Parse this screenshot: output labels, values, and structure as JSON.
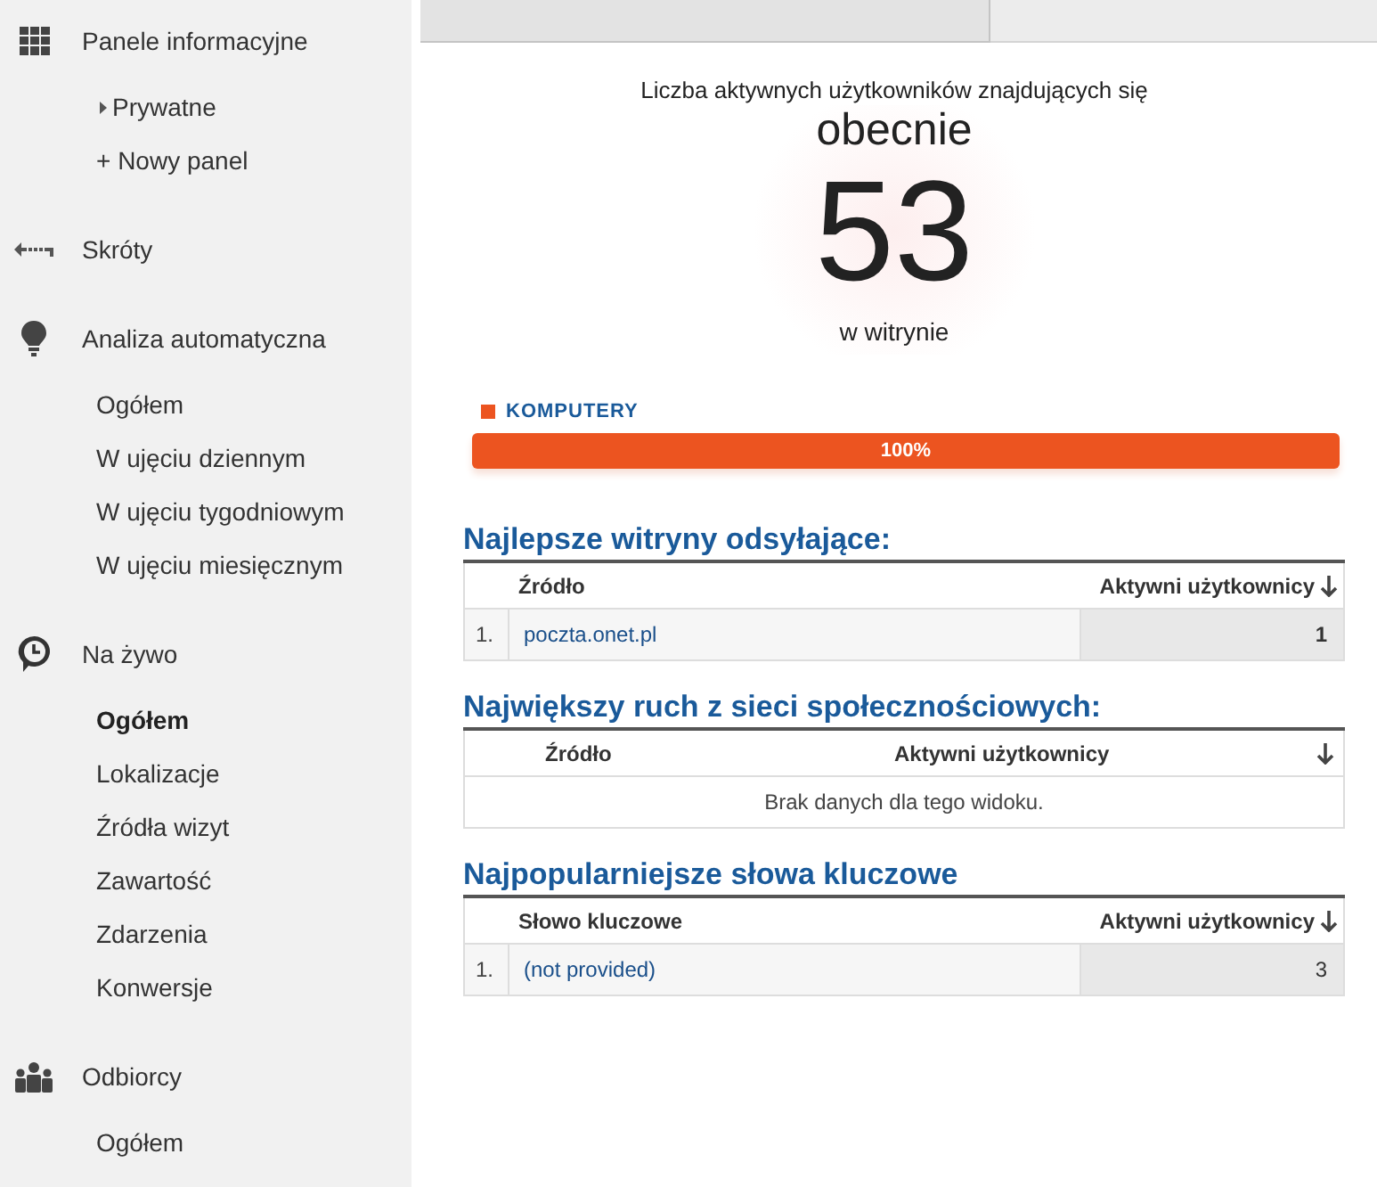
{
  "sidebar": {
    "sections": [
      {
        "label": "Panele informacyjne",
        "kind": "grid",
        "children": [
          {
            "label": "Prywatne",
            "kind": "folder",
            "expanded": false,
            "selected": false
          },
          {
            "label": "+ Nowy panel",
            "kind": "plain",
            "selected": false
          }
        ]
      },
      {
        "label": "Skróty",
        "kind": "shortcut"
      },
      {
        "label": "Analiza automatyczna",
        "kind": "bulb",
        "children": [
          {
            "label": "Ogółem",
            "kind": "plain",
            "selected": false
          },
          {
            "label": "W ujęciu dziennym",
            "kind": "plain",
            "selected": false
          },
          {
            "label": "W ujęciu tygodniowym",
            "kind": "plain",
            "selected": false
          },
          {
            "label": "W ujęciu miesięcznym",
            "kind": "plain",
            "selected": false
          }
        ]
      },
      {
        "label": "Na żywo",
        "kind": "clock",
        "children": [
          {
            "label": "Ogółem",
            "kind": "plain",
            "selected": true
          },
          {
            "label": "Lokalizacje",
            "kind": "plain",
            "selected": false
          },
          {
            "label": "Źródła wizyt",
            "kind": "plain",
            "selected": false
          },
          {
            "label": "Zawartość",
            "kind": "plain",
            "selected": false
          },
          {
            "label": "Zdarzenia",
            "kind": "plain",
            "selected": false
          },
          {
            "label": "Konwersje",
            "kind": "plain",
            "selected": false
          }
        ]
      },
      {
        "label": "Odbiorcy",
        "kind": "people",
        "children": [
          {
            "label": "Ogółem",
            "kind": "plain",
            "selected": false
          }
        ]
      }
    ]
  },
  "active_users": {
    "caption": "Liczba aktywnych użytkowników znajdujących się",
    "when": "obecnie",
    "count": "53",
    "where": "w witrynie"
  },
  "devices": [
    {
      "label": "KOMPUTERY",
      "color": "#ec5420",
      "level": 1,
      "reading": "100%"
    }
  ],
  "tables": [
    {
      "title": "Najlepsze witryny odsyłające:",
      "kind": "ranked",
      "columns": [
        {
          "label": "Źródło",
          "sorted": false
        },
        {
          "label": "Aktywni użytkownicy",
          "sorted": true
        }
      ],
      "rows": [
        {
          "rank": "1.",
          "name": "poczta.onet.pl",
          "value": "1"
        }
      ]
    },
    {
      "title": "Największy ruch z sieci społecznościowych:",
      "kind": "empty",
      "columns": [
        {
          "label": "Źródło",
          "sorted": false
        },
        {
          "label": "Aktywni użytkownicy",
          "sorted": true
        }
      ],
      "message": "Brak danych dla tego widoku."
    },
    {
      "title": "Najpopularniejsze słowa kluczowe",
      "kind": "ranked",
      "columns": [
        {
          "label": "Słowo kluczowe",
          "sorted": false
        },
        {
          "label": "Aktywni użytkownicy",
          "sorted": true
        }
      ],
      "rows": [
        {
          "rank": "1.",
          "name": "(not provided)",
          "value": "3"
        }
      ]
    }
  ]
}
